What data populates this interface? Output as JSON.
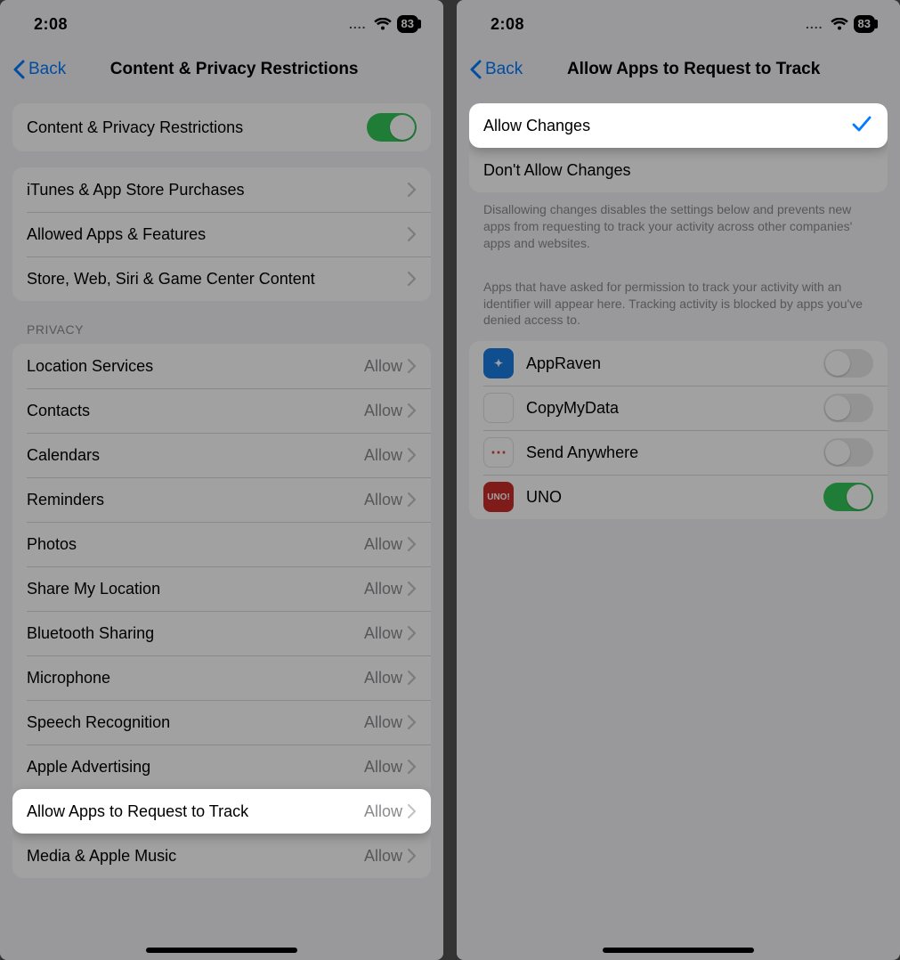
{
  "status": {
    "time": "2:08",
    "battery": "83",
    "dots": "...."
  },
  "left": {
    "back": "Back",
    "title": "Content & Privacy Restrictions",
    "master_toggle": "Content & Privacy Restrictions",
    "group1": [
      "iTunes & App Store Purchases",
      "Allowed Apps & Features",
      "Store, Web, Siri & Game Center Content"
    ],
    "privacy_header": "PRIVACY",
    "privacy_items": [
      {
        "label": "Location Services",
        "value": "Allow"
      },
      {
        "label": "Contacts",
        "value": "Allow"
      },
      {
        "label": "Calendars",
        "value": "Allow"
      },
      {
        "label": "Reminders",
        "value": "Allow"
      },
      {
        "label": "Photos",
        "value": "Allow"
      },
      {
        "label": "Share My Location",
        "value": "Allow"
      },
      {
        "label": "Bluetooth Sharing",
        "value": "Allow"
      },
      {
        "label": "Microphone",
        "value": "Allow"
      },
      {
        "label": "Speech Recognition",
        "value": "Allow"
      },
      {
        "label": "Apple Advertising",
        "value": "Allow"
      },
      {
        "label": "Allow Apps to Request to Track",
        "value": "Allow",
        "highlight": true
      },
      {
        "label": "Media & Apple Music",
        "value": "Allow"
      }
    ]
  },
  "right": {
    "back": "Back",
    "title": "Allow Apps to Request to Track",
    "options": [
      {
        "label": "Allow Changes",
        "checked": true,
        "highlight": true
      },
      {
        "label": "Don't Allow Changes",
        "checked": false
      }
    ],
    "footer1": "Disallowing changes disables the settings below and prevents new apps from requesting to track your activity across other companies' apps and websites.",
    "footer2": "Apps that have asked for permission to track your activity with an identifier will appear here. Tracking activity is blocked by apps you've denied access to.",
    "apps": [
      {
        "label": "AppRaven",
        "on": false,
        "icon": "appraven"
      },
      {
        "label": "CopyMyData",
        "on": false,
        "icon": "copymydata"
      },
      {
        "label": "Send Anywhere",
        "on": false,
        "icon": "sendanywhere"
      },
      {
        "label": "UNO",
        "on": true,
        "icon": "uno"
      }
    ]
  }
}
